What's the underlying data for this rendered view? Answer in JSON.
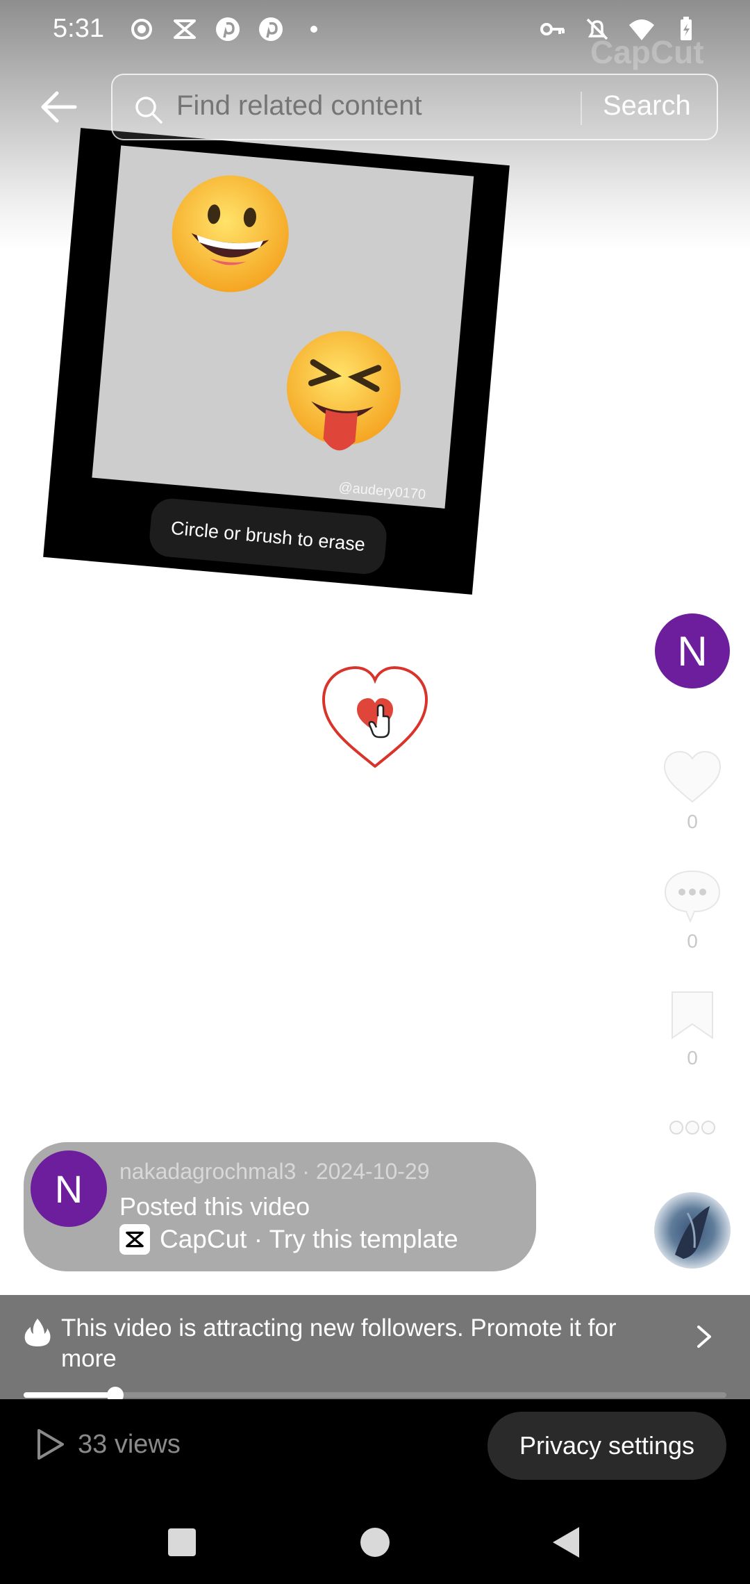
{
  "status_bar": {
    "time": "5:31"
  },
  "watermark": {
    "text": "CapCut"
  },
  "search": {
    "placeholder": "Find related content",
    "button_label": "Search"
  },
  "video": {
    "overlay_text": "Circle or brush to erase",
    "tiktok_handle": "@audery0170"
  },
  "actions": {
    "avatar_letter": "N",
    "likes": "0",
    "comments": "0",
    "saves": "0"
  },
  "info_card": {
    "avatar_letter": "N",
    "meta": "nakadagrochmal3 · 2024-10-29",
    "posted": "Posted this video",
    "template": "CapCut · Try this template"
  },
  "promote": {
    "text": "This video is attracting new followers. Promote it for more"
  },
  "progress": {
    "fraction": 0.13
  },
  "bottom": {
    "views": "33 views",
    "privacy_label": "Privacy settings"
  },
  "colors": {
    "avatar_purple": "#6c1e9c",
    "heart_red": "#e0453a"
  }
}
